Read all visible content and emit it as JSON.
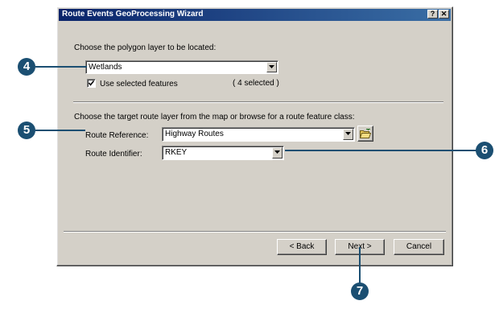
{
  "dialog": {
    "title": "Route Events GeoProcessing Wizard",
    "help_label": "?",
    "close_label": "✕"
  },
  "polygon": {
    "prompt": "Choose the polygon layer to be located:",
    "layer_value": "Wetlands",
    "use_selected_label": "Use selected features",
    "use_selected_checked": true,
    "selected_count": "( 4 selected )"
  },
  "route": {
    "prompt": "Choose the target route layer from the map or browse for a route feature class:",
    "reference_label": "Route Reference:",
    "reference_value": "Highway Routes",
    "identifier_label": "Route Identifier:",
    "identifier_value": "RKEY",
    "browse_icon": "folder-browse-icon"
  },
  "buttons": {
    "back": "< Back",
    "next": "Next >",
    "cancel": "Cancel"
  },
  "callouts": {
    "c4": "4",
    "c5": "5",
    "c6": "6",
    "c7": "7"
  },
  "colors": {
    "callout": "#1b4f72",
    "title_start": "#0a246a",
    "title_end": "#3a6ea5",
    "face": "#d4d0c8"
  }
}
